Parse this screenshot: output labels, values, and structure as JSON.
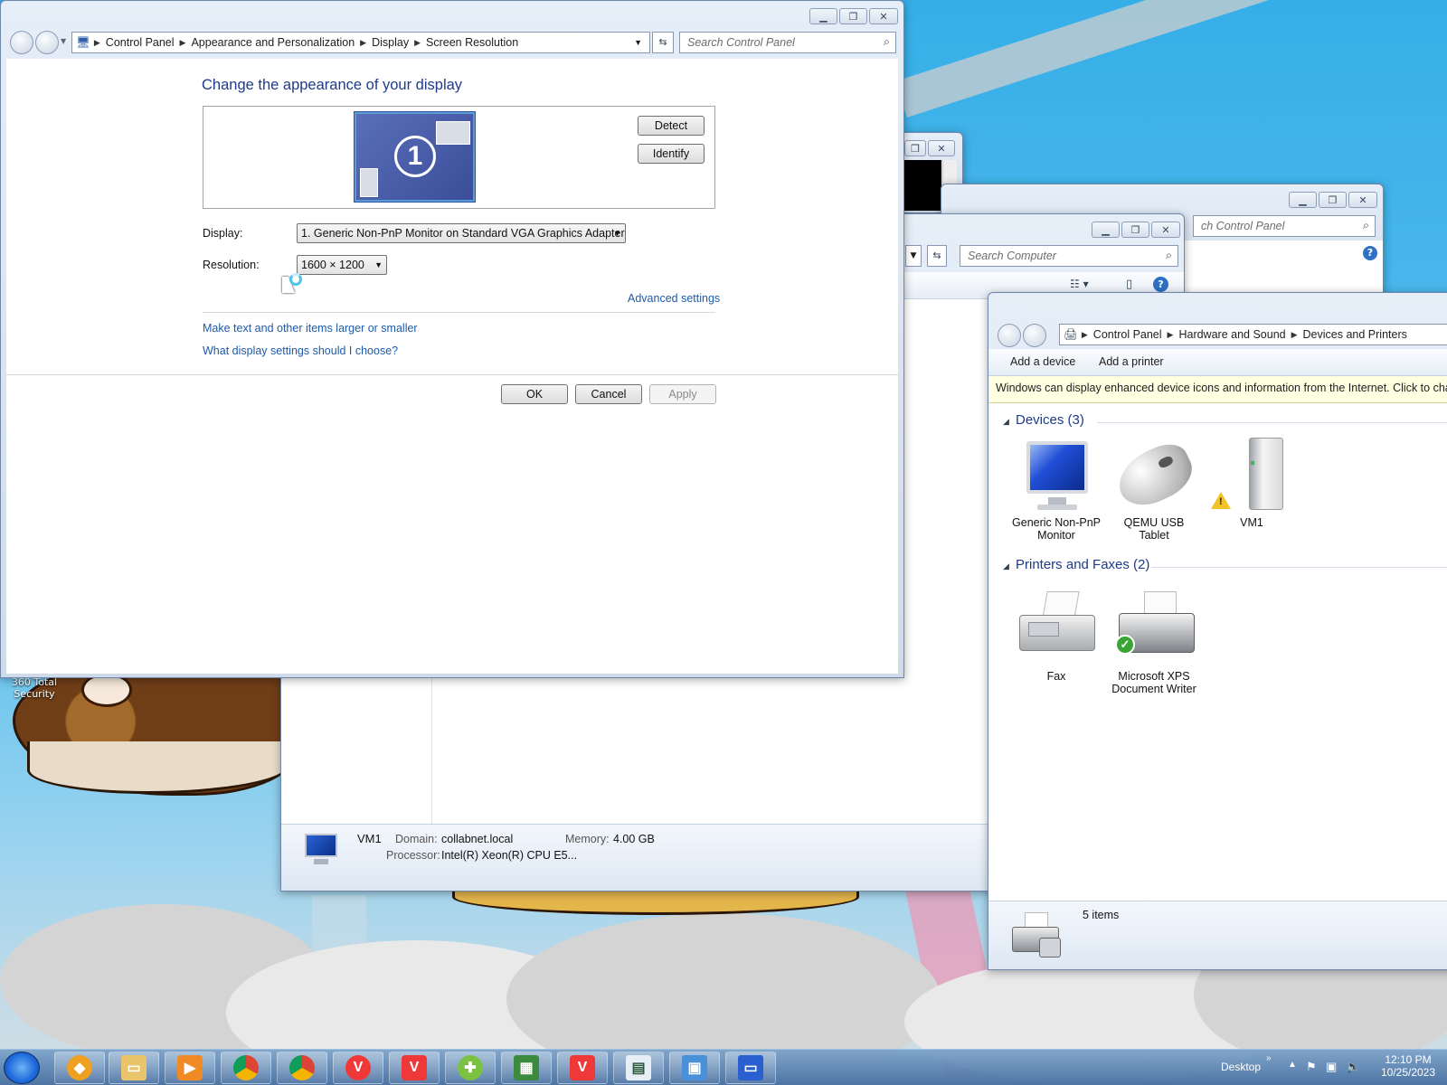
{
  "screen_resolution_window": {
    "breadcrumb": [
      "Control Panel",
      "Appearance and Personalization",
      "Display",
      "Screen Resolution"
    ],
    "search_placeholder": "Search Control Panel",
    "heading": "Change the appearance of your display",
    "monitor_number": "1",
    "detect_label": "Detect",
    "identify_label": "Identify",
    "display_label": "Display:",
    "display_value": "1. Generic Non-PnP Monitor on Standard VGA Graphics Adapter",
    "resolution_label": "Resolution:",
    "resolution_value": "1600 × 1200",
    "advanced_settings": "Advanced settings",
    "link_text_size": "Make text and other items larger or smaller",
    "link_which_settings": "What display settings should I choose?",
    "ok_label": "OK",
    "cancel_label": "Cancel",
    "apply_label": "Apply"
  },
  "computer_window": {
    "search_placeholder": "Search Computer",
    "computer_name": "VM1",
    "domain_label": "Domain:",
    "domain_value": "collabnet.local",
    "memory_label": "Memory:",
    "memory_value": "4.00 GB",
    "processor_label": "Processor:",
    "processor_value": "Intel(R) Xeon(R) CPU E5..."
  },
  "control_panel_window": {
    "search_partial": "ch Control Panel"
  },
  "devices_window": {
    "breadcrumb": [
      "Control Panel",
      "Hardware and Sound",
      "Devices and Printers"
    ],
    "add_device": "Add a device",
    "add_printer": "Add a printer",
    "infobar": "Windows can display enhanced device icons and information from the Internet. Click to chang",
    "devices_group": "Devices (3)",
    "devices": [
      {
        "line1": "Generic Non-PnP",
        "line2": "Monitor",
        "icon": "monitor-icon"
      },
      {
        "line1": "QEMU USB",
        "line2": "Tablet",
        "icon": "mouse-icon"
      },
      {
        "line1": "VM1",
        "line2": "",
        "icon": "computer-tower-icon"
      }
    ],
    "printers_group": "Printers and Faxes (2)",
    "printers": [
      {
        "line1": "Fax",
        "line2": "",
        "icon": "fax-icon"
      },
      {
        "line1": "Microsoft XPS",
        "line2": "Document Writer",
        "icon": "printer-icon"
      }
    ],
    "status_items": "5 items"
  },
  "desktop": {
    "icon_label_1": "360 Total",
    "icon_label_2": "Security"
  },
  "taskbar": {
    "desktop_label": "Desktop",
    "time": "12:10 PM",
    "date": "10/25/2023"
  }
}
